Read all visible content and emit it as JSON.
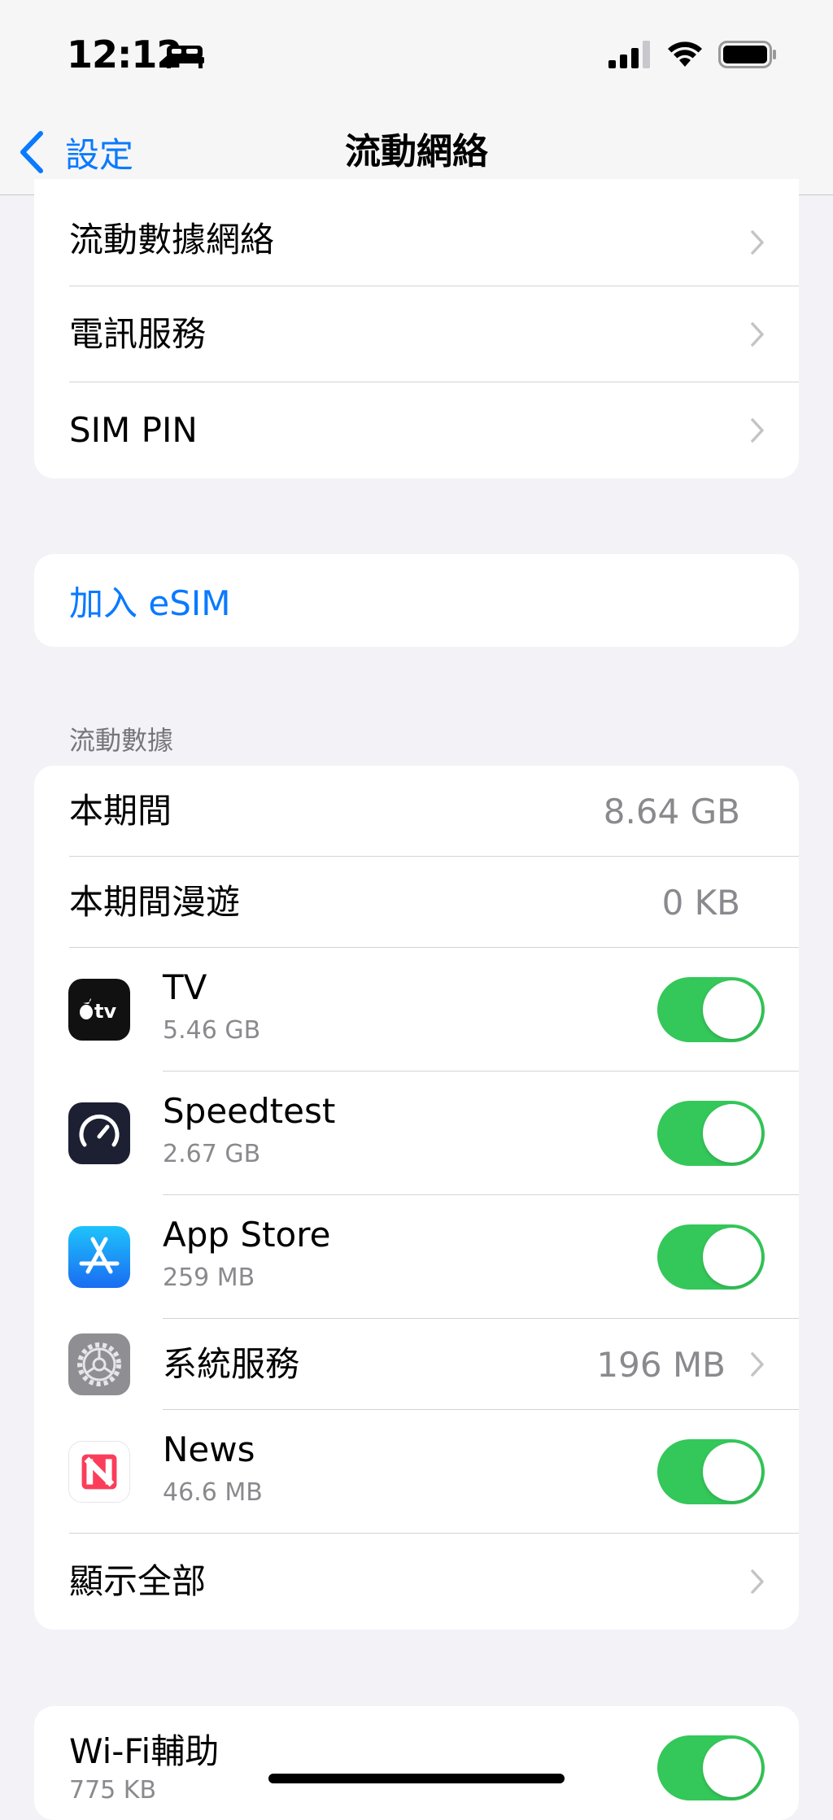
{
  "status_bar": {
    "time": "12:12"
  },
  "nav": {
    "back_label": "設定",
    "title": "流動網絡"
  },
  "group1": {
    "rows": [
      {
        "label": "流動數據網絡"
      },
      {
        "label": "電訊服務"
      },
      {
        "label": "SIM PIN"
      }
    ]
  },
  "esim": {
    "label": "加入 eSIM"
  },
  "cellular_data": {
    "header": "流動數據",
    "current_period": {
      "label": "本期間",
      "value": "8.64 GB"
    },
    "roaming": {
      "label": "本期間漫遊",
      "value": "0 KB"
    },
    "apps": [
      {
        "name": "TV",
        "size": "5.46 GB",
        "enabled": true,
        "icon": "apple-tv-icon"
      },
      {
        "name": "Speedtest",
        "size": "2.67 GB",
        "enabled": true,
        "icon": "speedtest-icon"
      },
      {
        "name": "App Store",
        "size": "259 MB",
        "enabled": true,
        "icon": "app-store-icon"
      },
      {
        "name": "系統服務",
        "value": "196 MB",
        "icon": "settings-gear-icon"
      },
      {
        "name": "News",
        "size": "46.6 MB",
        "enabled": true,
        "icon": "news-icon"
      }
    ],
    "show_all": {
      "label": "顯示全部"
    }
  },
  "wifi_assist": {
    "label": "Wi-Fi輔助",
    "size": "775 KB",
    "enabled": true
  },
  "colors": {
    "accent": "#0a7aff",
    "toggle_on": "#34c759",
    "background": "#f2f2f7"
  }
}
